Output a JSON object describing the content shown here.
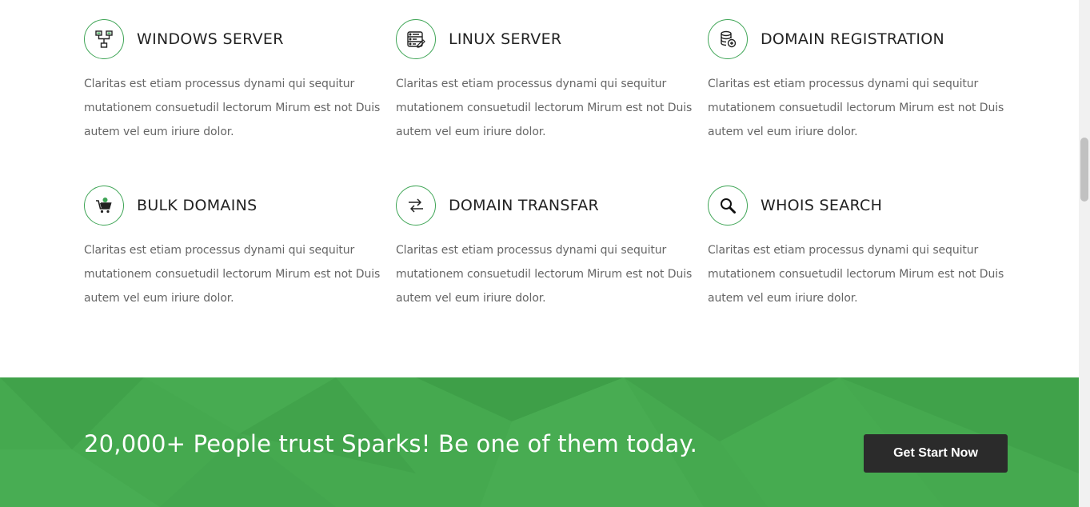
{
  "features": [
    {
      "title": "WINDOWS SERVER",
      "icon": "network-icon",
      "text": "Claritas est etiam processus dynami qui sequitur mutationem consuetudil lectorum Mirum est not Duis autem vel eum iriure dolor."
    },
    {
      "title": "LINUX SERVER",
      "icon": "server-list-icon",
      "text": "Claritas est etiam processus dynami qui sequitur mutationem consuetudil lectorum Mirum est not Duis autem vel eum iriure dolor."
    },
    {
      "title": "DOMAIN REGISTRATION",
      "icon": "database-add-icon",
      "text": "Claritas est etiam processus dynami qui sequitur mutationem consuetudil lectorum Mirum est not Duis autem vel eum iriure dolor."
    },
    {
      "title": "BULK DOMAINS",
      "icon": "cart-icon",
      "text": "Claritas est etiam processus dynami qui sequitur mutationem consuetudil lectorum Mirum est not Duis autem vel eum iriure dolor."
    },
    {
      "title": "DOMAIN TRANSFAR",
      "icon": "transfer-arrows-icon",
      "text": "Claritas est etiam processus dynami qui sequitur mutationem consuetudil lectorum Mirum est not Duis autem vel eum iriure dolor."
    },
    {
      "title": "WHOIS SEARCH",
      "icon": "search-icon",
      "text": "Claritas est etiam processus dynami qui sequitur mutationem consuetudil lectorum Mirum est not Duis autem vel eum iriure dolor."
    }
  ],
  "cta": {
    "text": "20,000+ People trust Sparks! Be one of them today.",
    "button_label": "Get Start Now"
  },
  "colors": {
    "accent": "#45a94f",
    "icon_border": "#3fa556",
    "button_bg": "#2b2b2b",
    "heading": "#222222",
    "body_text": "#666666"
  }
}
